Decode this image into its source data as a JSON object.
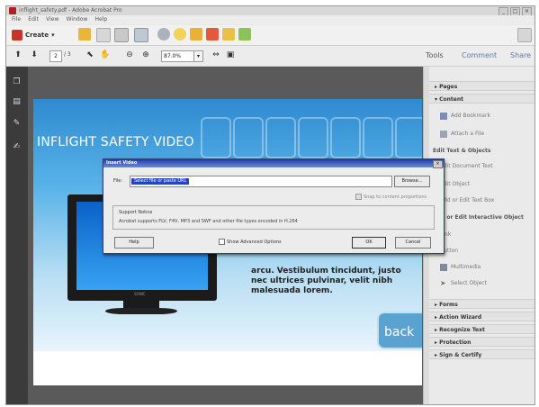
{
  "window": {
    "title": "inflight_safety.pdf - Adobe Acrobat Pro",
    "controls": [
      "_",
      "□",
      "×"
    ]
  },
  "menubar": [
    "File",
    "Edit",
    "View",
    "Window",
    "Help"
  ],
  "toolbar": {
    "create_label": "Create",
    "icons": [
      "combine-icon",
      "open-icon",
      "save-icon",
      "print-icon",
      "email-icon",
      "settings-icon",
      "comment-icon",
      "stamp-icon",
      "highlight-icon",
      "attach-icon",
      "review-icon"
    ]
  },
  "nav": {
    "page_current": "2",
    "page_total": "/ 3",
    "zoom": "87.0%",
    "zoom_dropdown": "▾"
  },
  "topnav": {
    "tools": "Tools",
    "comment": "Comment",
    "share": "Share"
  },
  "document": {
    "title": "INFLIGHT SAFETY VIDEO",
    "monitor_brand": "SONIC",
    "body_text": "arcu. Vestibulum tincidunt, justo nec ultrices pulvinar, velit nibh malesuada lorem.",
    "back_label": "back"
  },
  "rightpanel": {
    "pages": "▸ Pages",
    "content": "▾ Content",
    "add_bookmark": "Add Bookmark",
    "attach_file": "Attach a File",
    "edit_text_objects": "Edit Text & Objects",
    "edit_document_text": "Edit Document Text",
    "edit_object": "Edit Object",
    "add_edit_text_box": "Add or Edit Text Box",
    "add_edit_interactive": "Add or Edit Interactive Object",
    "link": "Link",
    "button": "Button",
    "multimedia": "Multimedia",
    "select_object": "Select Object",
    "forms": "▸ Forms",
    "action_wizard": "▸ Action Wizard",
    "recognize_text": "▸ Recognize Text",
    "protection": "▸ Protection",
    "sign_certify": "▸ Sign & Certify"
  },
  "dialog": {
    "title": "Insert Video",
    "close": "×",
    "file_label": "File:",
    "file_value": "Select file or paste URL",
    "browse": "Browse...",
    "snap_label": "Snap to content proportions",
    "support_heading": "Support Notice",
    "support_text": "Acrobat supports FLV, F4V, MP3 and SWF and other file types encoded in H.264",
    "help": "Help",
    "advanced": "Show Advanced Options",
    "ok": "OK",
    "cancel": "Cancel"
  },
  "colors": {
    "accent": "#5a7ba6",
    "dialog_title": "#1f3fa0",
    "selection": "#2646b8"
  }
}
